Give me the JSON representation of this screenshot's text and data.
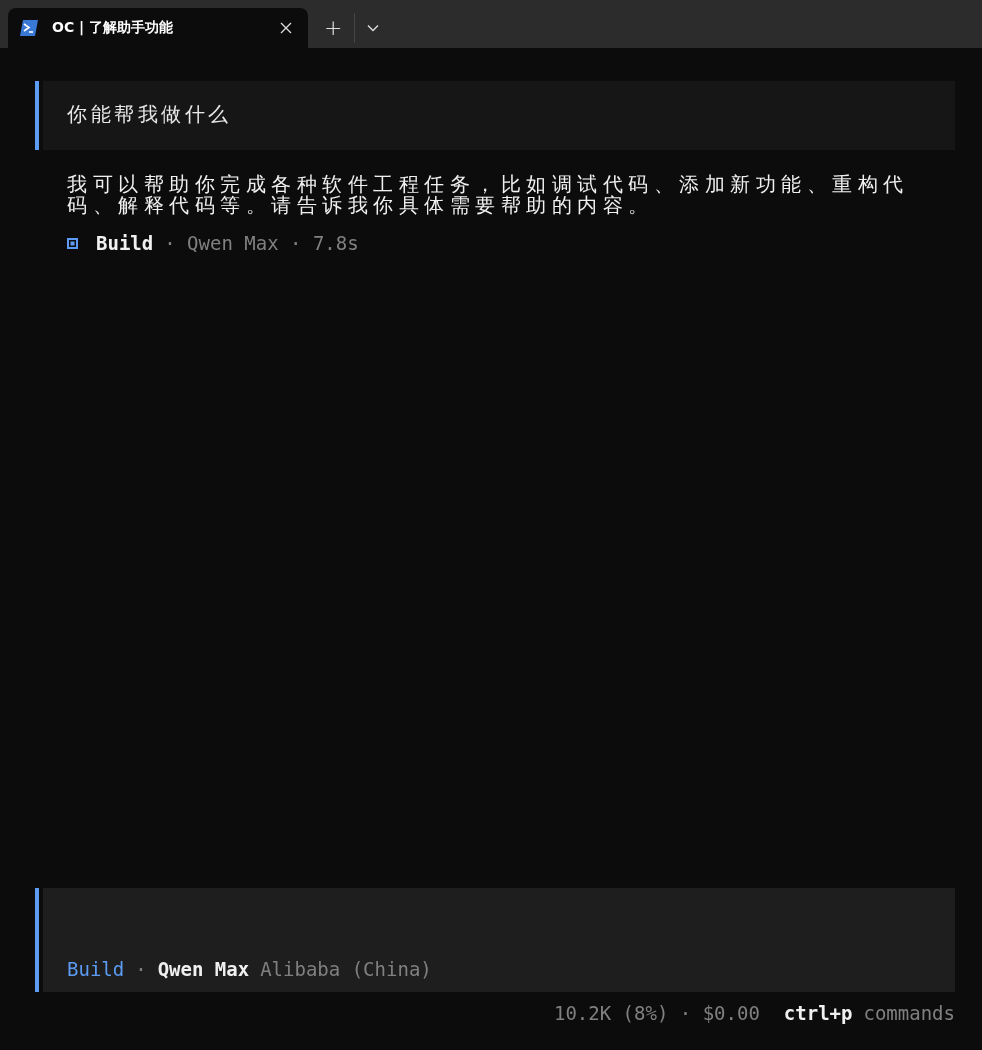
{
  "tabs": [
    {
      "title": "OC | 了解助手功能",
      "selected": true
    }
  ],
  "tab_actions": {
    "new": "+"
  },
  "conversation": {
    "user_message": "你能帮我做什么",
    "reply": "我可以帮助你完成各种软件工程任务，比如调试代码、添加新功能、重构代码、解释代码等。请告诉我你具体需要帮助的内容。",
    "meta": {
      "agent": "Build",
      "details": "· Qwen Max · 7.8s"
    }
  },
  "prompt": {
    "agent": "Build",
    "separator": "·",
    "model": "Qwen Max",
    "provider": "Alibaba (China)"
  },
  "status_bar": {
    "usage": "10.2K (8%) · $0.00",
    "shortcut": "ctrl+p",
    "shortcut_label": "commands"
  }
}
